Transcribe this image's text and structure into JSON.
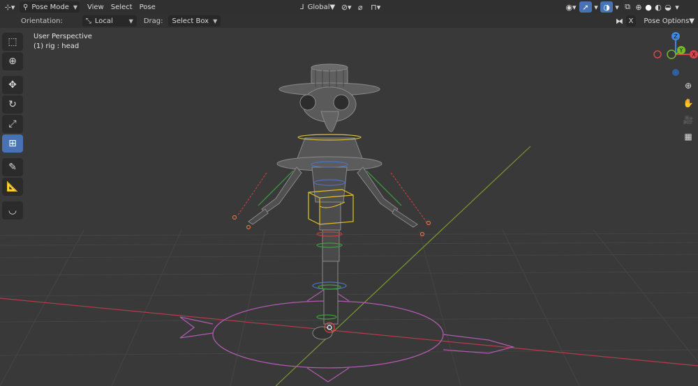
{
  "header": {
    "mode": "Pose Mode",
    "menus": [
      "View",
      "Select",
      "Pose"
    ],
    "transform_orientation": "Global",
    "shading_modes": [
      "wireframe",
      "solid",
      "material",
      "rendered"
    ],
    "active_shading": "solid"
  },
  "tool_header": {
    "orientation_label": "Orientation:",
    "orientation_value": "Local",
    "drag_label": "Drag:",
    "drag_value": "Select Box",
    "x_mirror": "X",
    "pose_options": "Pose Options"
  },
  "overlay_text": {
    "view": "User Perspective",
    "object": "(1) rig : head"
  },
  "gizmo": {
    "x_label": "X",
    "y_label": "Y",
    "z_label": "Z",
    "x_color": "#e0424a",
    "y_color": "#76b82a",
    "z_color": "#3f88dd"
  },
  "toolbar": {
    "tools": [
      "select-box",
      "cursor",
      "move",
      "rotate",
      "scale",
      "transform",
      "annotate",
      "measure",
      "bone-relax"
    ],
    "active_tool": "transform"
  },
  "colors": {
    "accent": "#4772b3",
    "background": "#393939",
    "header": "#303030",
    "grid_x_axis": "#b83b4c",
    "grid_y_axis": "#7b9a2b",
    "bone_widget": "#b05ab0"
  }
}
